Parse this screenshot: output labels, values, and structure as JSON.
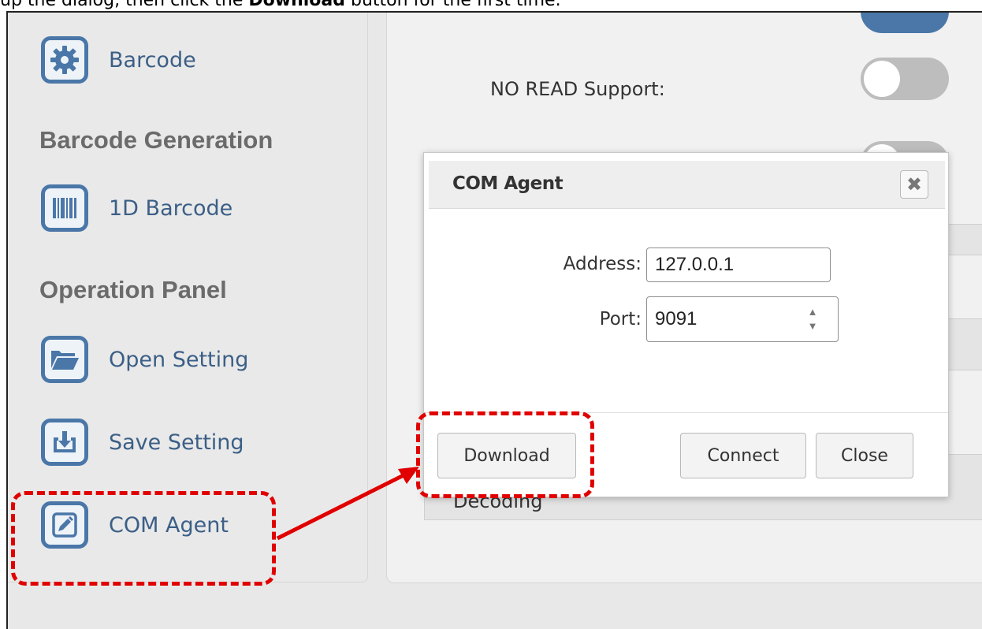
{
  "caption": {
    "before": "up the dialog, then click the ",
    "bold": "Download",
    "after": " button for the first time."
  },
  "sidebar": {
    "items": [
      {
        "label": "Barcode",
        "icon": "gear-icon"
      },
      {
        "label": "1D Barcode",
        "icon": "barcode-icon"
      },
      {
        "label": "Open Setting",
        "icon": "folder-icon"
      },
      {
        "label": "Save Setting",
        "icon": "download-icon"
      },
      {
        "label": "COM Agent",
        "icon": "edit-icon"
      }
    ],
    "headings": [
      "Barcode Generation",
      "Operation Panel"
    ]
  },
  "settings": {
    "no_read_label": "NO READ Support:"
  },
  "dialog": {
    "title": "COM Agent",
    "close_icon": "✖",
    "address_label": "Address:",
    "address_value": "127.0.0.1",
    "port_label": "Port:",
    "port_value": "9091",
    "download_label": "Download",
    "connect_label": "Connect",
    "close_label": "Close"
  },
  "behind": {
    "decoding_text": "Decoding"
  },
  "colors": {
    "accent": "#4a77a8",
    "highlight": "#e00000"
  }
}
